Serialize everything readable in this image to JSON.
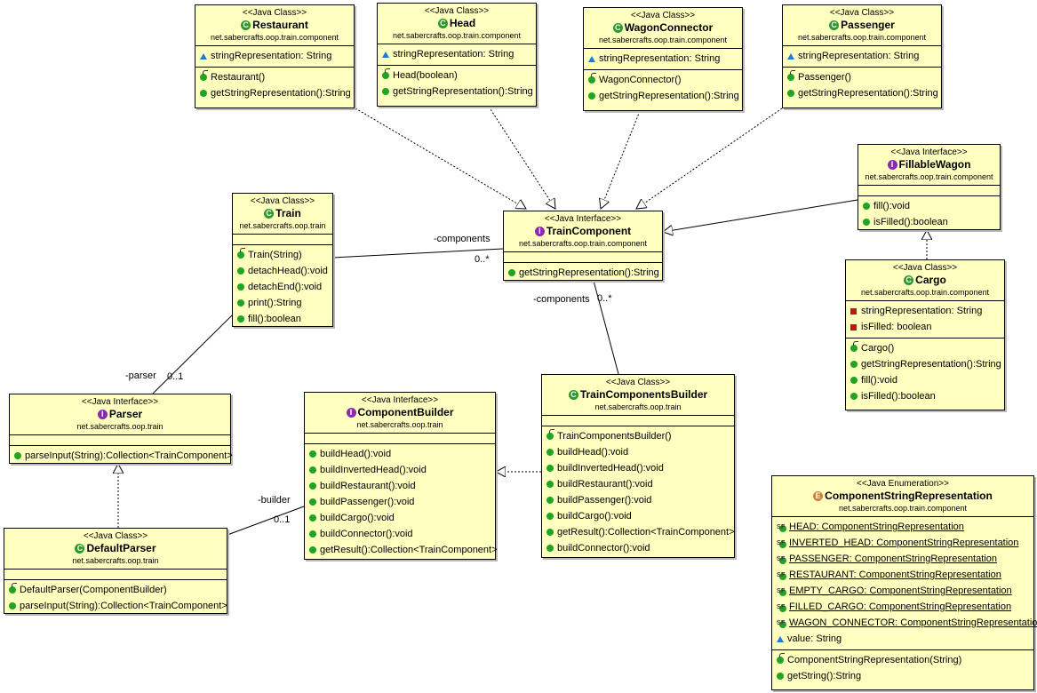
{
  "classes": {
    "restaurant": {
      "stereotype": "<<Java Class>>",
      "name": "Restaurant",
      "package": "net.sabercrafts.oop.train.component",
      "fields": [
        "stringRepresentation: String"
      ],
      "methods": [
        "Restaurant()",
        "getStringRepresentation():String"
      ]
    },
    "head": {
      "stereotype": "<<Java Class>>",
      "name": "Head",
      "package": "net.sabercrafts.oop.train.component",
      "fields": [
        "stringRepresentation: String"
      ],
      "methods": [
        "Head(boolean)",
        "getStringRepresentation():String"
      ]
    },
    "wagon_connector": {
      "stereotype": "<<Java Class>>",
      "name": "WagonConnector",
      "package": "net.sabercrafts.oop.train.component",
      "fields": [
        "stringRepresentation: String"
      ],
      "methods": [
        "WagonConnector()",
        "getStringRepresentation():String"
      ]
    },
    "passenger": {
      "stereotype": "<<Java Class>>",
      "name": "Passenger",
      "package": "net.sabercrafts.oop.train.component",
      "fields": [
        "stringRepresentation: String"
      ],
      "methods": [
        "Passenger()",
        "getStringRepresentation():String"
      ]
    },
    "fillable_wagon": {
      "stereotype": "<<Java Interface>>",
      "name": "FillableWagon",
      "package": "net.sabercrafts.oop.train.component",
      "fields": [],
      "methods": [
        "fill():void",
        "isFilled():boolean"
      ]
    },
    "train": {
      "stereotype": "<<Java Class>>",
      "name": "Train",
      "package": "net.sabercrafts.oop.train",
      "fields": [],
      "methods": [
        "Train(String)",
        "detachHead():void",
        "detachEnd():void",
        "print():String",
        "fill():boolean"
      ]
    },
    "train_component": {
      "stereotype": "<<Java Interface>>",
      "name": "TrainComponent",
      "package": "net.sabercrafts.oop.train.component",
      "fields": [],
      "methods": [
        "getStringRepresentation():String"
      ]
    },
    "cargo": {
      "stereotype": "<<Java Class>>",
      "name": "Cargo",
      "package": "net.sabercrafts.oop.train.component",
      "fields": [
        "stringRepresentation: String",
        "isFilled: boolean"
      ],
      "methods": [
        "Cargo()",
        "getStringRepresentation():String",
        "fill():void",
        "isFilled():boolean"
      ]
    },
    "parser": {
      "stereotype": "<<Java Interface>>",
      "name": "Parser",
      "package": "net.sabercrafts.oop.train",
      "fields": [],
      "methods": [
        "parseInput(String):Collection<TrainComponent>"
      ]
    },
    "component_builder": {
      "stereotype": "<<Java Interface>>",
      "name": "ComponentBuilder",
      "package": "net.sabercrafts.oop.train",
      "fields": [],
      "methods": [
        "buildHead():void",
        "buildInvertedHead():void",
        "buildRestaurant():void",
        "buildPassenger():void",
        "buildCargo():void",
        "buildConnector():void",
        "getResult():Collection<TrainComponent>"
      ]
    },
    "train_components_builder": {
      "stereotype": "<<Java Class>>",
      "name": "TrainComponentsBuilder",
      "package": "net.sabercrafts.oop.train",
      "fields": [],
      "methods": [
        "TrainComponentsBuilder()",
        "buildHead():void",
        "buildInvertedHead():void",
        "buildRestaurant():void",
        "buildPassenger():void",
        "buildCargo():void",
        "getResult():Collection<TrainComponent>",
        "buildConnector():void"
      ]
    },
    "default_parser": {
      "stereotype": "<<Java Class>>",
      "name": "DefaultParser",
      "package": "net.sabercrafts.oop.train",
      "fields": [],
      "methods": [
        "DefaultParser(ComponentBuilder)",
        "parseInput(String):Collection<TrainComponent>"
      ]
    },
    "component_string_representation": {
      "stereotype": "<<Java Enumeration>>",
      "name": "ComponentStringRepresentation",
      "package": "net.sabercrafts.oop.train.component",
      "fields": [
        "HEAD: ComponentStringRepresentation",
        "INVERTED_HEAD: ComponentStringRepresentation",
        "PASSENGER: ComponentStringRepresentation",
        "RESTAURANT: ComponentStringRepresentation",
        "EMPTY_CARGO: ComponentStringRepresentation",
        "FILLED_CARGO: ComponentStringRepresentation",
        "WAGON_CONNECTOR: ComponentStringRepresentation",
        "value: String"
      ],
      "methods": [
        "ComponentStringRepresentation(String)",
        "getString():String"
      ]
    }
  },
  "labels": {
    "train_components_role": "-components",
    "train_components_mult": "0..*",
    "builder_components_role": "-components",
    "builder_components_mult": "0..*",
    "parser_role": "-parser",
    "parser_mult": "0..1",
    "builder_role": "-builder",
    "builder_mult": "0..1"
  }
}
